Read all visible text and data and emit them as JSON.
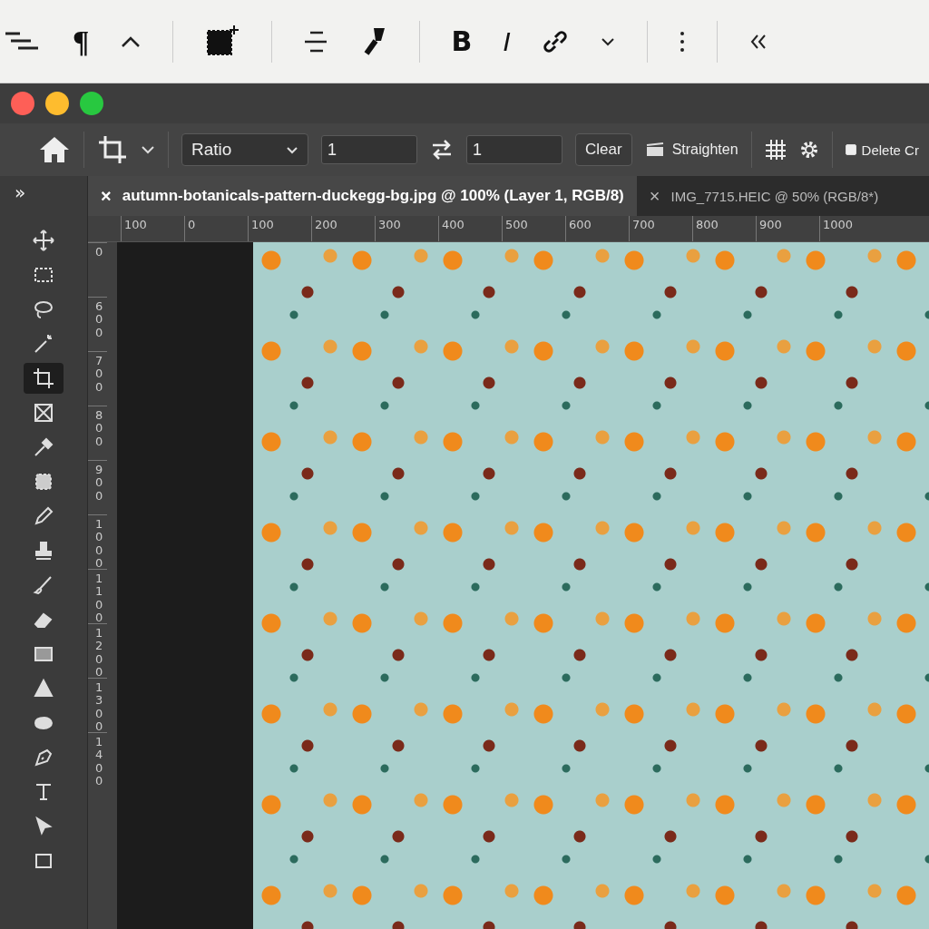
{
  "editor_toolbar": {
    "paragraph": "¶",
    "bold": "B",
    "italic": "I"
  },
  "options_bar": {
    "aspect": {
      "value": "Ratio"
    },
    "width": {
      "value": "1"
    },
    "height": {
      "value": "1"
    },
    "clear": "Clear",
    "straighten": "Straighten",
    "delete_cropped": {
      "label": "Delete Cr",
      "checked": true
    }
  },
  "tabs": [
    {
      "label": "autumn-botanicals-pattern-duckegg-bg.jpg @ 100% (Layer 1, RGB/8)",
      "close": "×",
      "selected": true
    },
    {
      "label": "IMG_7715.HEIC @ 50% (RGB/8*)",
      "close": "×",
      "selected": false
    }
  ],
  "panel_toggle": "»",
  "tools": [
    {
      "kind": "move",
      "selected": false
    },
    {
      "kind": "marquee",
      "selected": false
    },
    {
      "kind": "lasso",
      "selected": false
    },
    {
      "kind": "wand",
      "selected": false
    },
    {
      "kind": "crop",
      "selected": true
    },
    {
      "kind": "frame",
      "selected": false
    },
    {
      "kind": "eyedropper",
      "selected": false
    },
    {
      "kind": "patch",
      "selected": false
    },
    {
      "kind": "pencil",
      "selected": false
    },
    {
      "kind": "stamp",
      "selected": false
    },
    {
      "kind": "history",
      "selected": false
    },
    {
      "kind": "eraser",
      "selected": false
    },
    {
      "kind": "gradient",
      "selected": false
    },
    {
      "kind": "blur",
      "selected": false
    },
    {
      "kind": "dodge",
      "selected": false
    },
    {
      "kind": "pen",
      "selected": false
    },
    {
      "kind": "type",
      "selected": false
    },
    {
      "kind": "select",
      "selected": false
    },
    {
      "kind": "shape",
      "selected": false
    }
  ],
  "ruler_horizontal": [
    "100",
    "0",
    "100",
    "200",
    "300",
    "400",
    "500",
    "600",
    "700",
    "800",
    "900",
    "1000"
  ],
  "ruler_vertical": [
    "0",
    "600",
    "700",
    "800",
    "900",
    "1000",
    "1100",
    "1200",
    "1300",
    "1400"
  ]
}
